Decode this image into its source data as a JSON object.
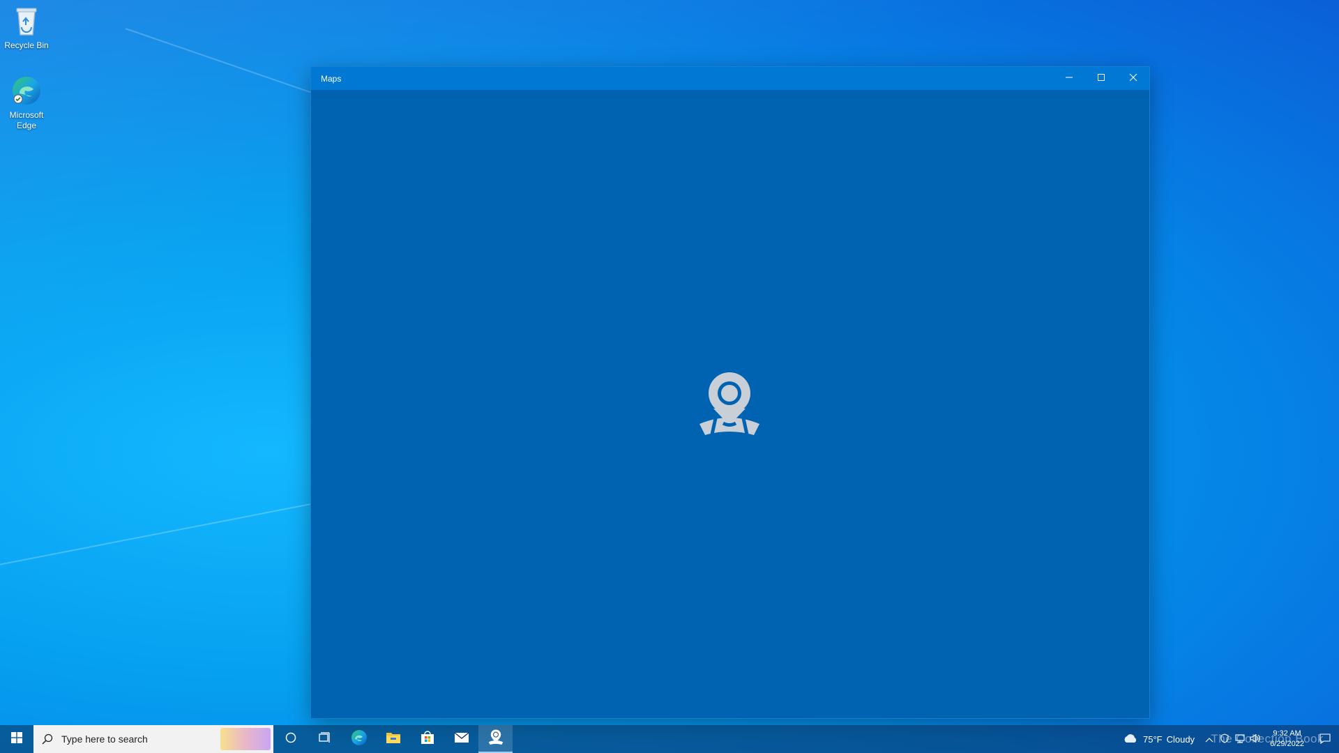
{
  "desktop": {
    "icons": [
      {
        "label": "Recycle Bin",
        "icon": "recycle-bin-icon"
      },
      {
        "label": "Microsoft Edge",
        "icon": "edge-icon"
      }
    ]
  },
  "window": {
    "title": "Maps",
    "controls": {
      "minimize": "minimize-icon",
      "maximize": "maximize-icon",
      "close": "close-icon"
    },
    "background": "#0063b1",
    "titlebar_color": "#0078d4",
    "splash_icon": "maps-pin-icon"
  },
  "taskbar": {
    "search_placeholder": "Type here to search",
    "pinned": [
      {
        "name": "cortana",
        "icon": "cortana-circle-icon"
      },
      {
        "name": "task-view",
        "icon": "task-view-icon"
      },
      {
        "name": "edge",
        "icon": "edge-icon"
      },
      {
        "name": "file-explorer",
        "icon": "folder-icon"
      },
      {
        "name": "store",
        "icon": "store-bag-icon"
      },
      {
        "name": "mail",
        "icon": "mail-icon"
      },
      {
        "name": "maps",
        "icon": "maps-pin-icon",
        "active": true
      }
    ],
    "weather": {
      "temp": "75°F",
      "condition": "Cloudy"
    },
    "clock": {
      "time": "9:32 AM",
      "date": "6/29/2022"
    }
  },
  "watermark": "The Collection Book"
}
